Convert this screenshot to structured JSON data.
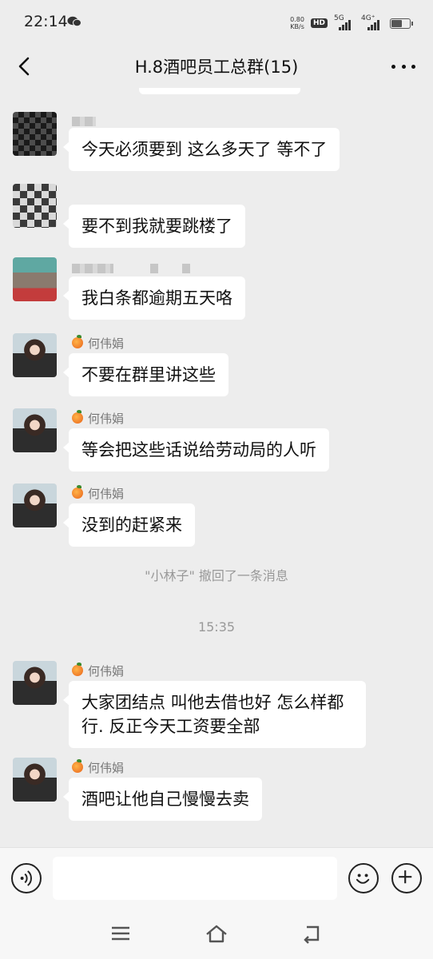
{
  "status_bar": {
    "time": "22:14",
    "net_speed_value": "0.80",
    "net_speed_unit": "KB/s",
    "hd_label": "HD",
    "sim1_label": "5G",
    "sim2_label": "4G⁺",
    "app_icon": "wechat-icon"
  },
  "nav": {
    "title": "H.8酒吧员工总群(15)",
    "back_icon": "back-arrow-icon",
    "more_icon": "more-dots-icon"
  },
  "messages": [
    {
      "sender": "",
      "sender_hidden": true,
      "text": "今天必须要到 这么多天了 等不了"
    },
    {
      "sender": "",
      "sender_hidden": true,
      "text": "要不到我就要跳楼了"
    },
    {
      "sender": "",
      "sender_hidden": true,
      "text": "我白条都逾期五天咯"
    },
    {
      "sender": "何伟娟",
      "text": "不要在群里讲这些"
    },
    {
      "sender": "何伟娟",
      "text": "等会把这些话说给劳动局的人听"
    },
    {
      "sender": "何伟娟",
      "text": "没到的赶紧来"
    },
    {
      "sender": "何伟娟",
      "text": "大家团结点 叫他去借也好 怎么样都行. 反正今天工资要全部"
    },
    {
      "sender": "何伟娟",
      "text": "酒吧让他自己慢慢去卖"
    }
  ],
  "system_notes": {
    "recall": "\"小林子\" 撤回了一条消息",
    "time_divider": "15:35"
  },
  "input_bar": {
    "value": "",
    "placeholder": "",
    "voice_icon": "voice-icon",
    "emoji_icon": "emoji-icon",
    "plus_icon": "plus-icon"
  },
  "system_nav": {
    "menu_icon": "menu-icon",
    "home_icon": "home-icon",
    "back_icon": "back-icon"
  },
  "colors": {
    "background": "#ededed",
    "bubble": "#ffffff",
    "system_text": "#999999"
  }
}
